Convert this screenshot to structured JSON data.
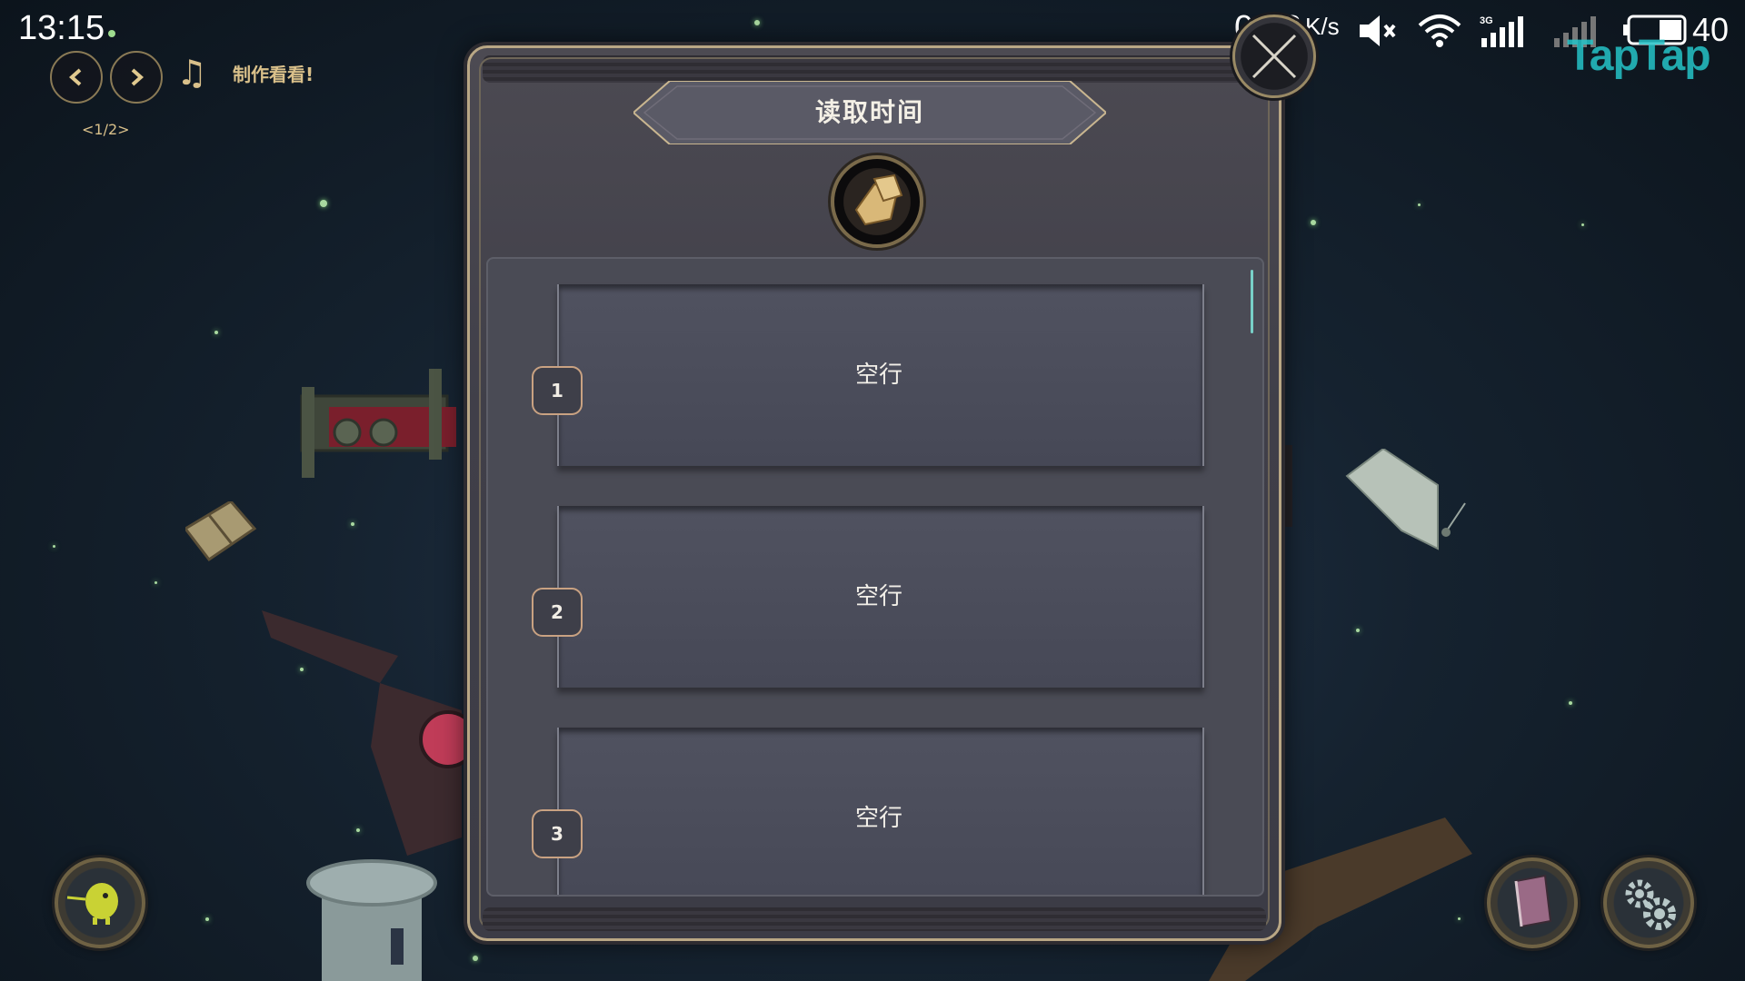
{
  "status_bar": {
    "time": "13:15",
    "net_speed": "0.02",
    "net_speed_unit": "K/s",
    "battery_level": "40",
    "icons": [
      "mute-icon",
      "wifi-icon",
      "signal-3g-icon",
      "signal-empty-icon",
      "battery-icon"
    ],
    "watermark": "TapTap"
  },
  "top_controls": {
    "prev_icon": "chevron-left-icon",
    "next_icon": "chevron-right-icon",
    "music_icon": "music-note-icon",
    "music_label": "制作看看!",
    "page_indicator": "<1/2>"
  },
  "dialog": {
    "title": "读取时间",
    "emblem_icon": "scroll-parchment-icon",
    "close_icon": "close-icon",
    "slots": [
      {
        "number": "1",
        "label": "空行"
      },
      {
        "number": "2",
        "label": "空行"
      },
      {
        "number": "3",
        "label": "空行"
      }
    ]
  },
  "corner_buttons": {
    "left": "character-icon",
    "book": "book-icon",
    "settings": "gear-icon"
  },
  "colors": {
    "accent_gold": "#b9a785",
    "panel": "#4a4b55",
    "watermark": "#25c3c7",
    "background": "#15222f"
  }
}
